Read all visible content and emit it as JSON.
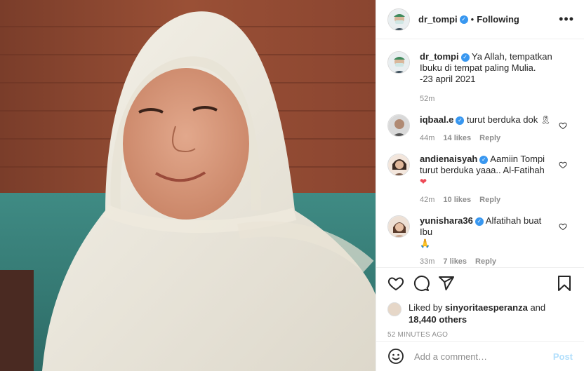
{
  "post": {
    "username": "dr_tompi",
    "follow_status": "Following",
    "caption_line1": "Ya Allah, tempatkan",
    "caption_line2": "Ibuku di tempat paling Mulia.",
    "caption_line3": "-23 april 2021",
    "caption_time": "52m"
  },
  "comments": [
    {
      "username": "iqbaal.e",
      "text": "turut berduka dok",
      "emoji": "🎗",
      "time": "44m",
      "likes": "14 likes",
      "reply": "Reply"
    },
    {
      "username": "andienaisyah",
      "text1": "Aamiin Tompi",
      "text2": "turut berduka yaaa.. Al-Fatihah",
      "emoji": "❤",
      "time": "42m",
      "likes": "10 likes",
      "reply": "Reply"
    },
    {
      "username": "yunishara36",
      "text": "Alfatihah buat Ibu",
      "emoji": "🙏",
      "time": "33m",
      "likes": "7 likes",
      "reply": "Reply"
    }
  ],
  "likes": {
    "prefix": "Liked by",
    "user": "sinyoritaesperanza",
    "conj": "and",
    "others": "18,440 others"
  },
  "timestamp": "52 MINUTES AGO",
  "add_comment": {
    "placeholder": "Add a comment…",
    "post_label": "Post"
  },
  "icons": {
    "like": "heart-icon",
    "comment": "comment-icon",
    "share": "share-icon",
    "save": "bookmark-icon",
    "emoji": "emoji-icon",
    "more": "more-icon",
    "verified": "verified-badge-icon"
  },
  "colors": {
    "verified": "#3897f0",
    "muted": "#8e8e8e",
    "post_disabled": "#b2dffc",
    "heart_emoji": "#ed4956"
  }
}
